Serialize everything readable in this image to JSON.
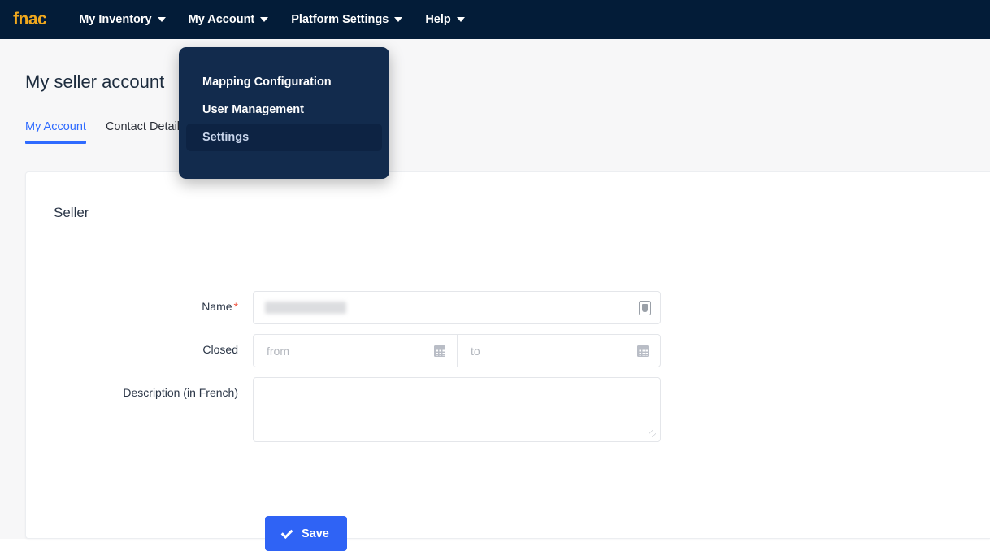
{
  "brand": {
    "name": "fnac",
    "color": "#f0a81e"
  },
  "navbar": {
    "background": "#031c38",
    "items": [
      {
        "label": "My Inventory",
        "has_caret": true
      },
      {
        "label": "My Account",
        "has_caret": true
      },
      {
        "label": "Platform Settings",
        "has_caret": true
      },
      {
        "label": "Help",
        "has_caret": true
      }
    ]
  },
  "dropdown": {
    "open_for": "My Account",
    "background": "#122b4d",
    "items": [
      {
        "label": "Mapping Configuration",
        "active": false
      },
      {
        "label": "User Management",
        "active": false
      },
      {
        "label": "Settings",
        "active": true
      }
    ]
  },
  "page": {
    "title": "My seller account",
    "accent_color": "#2f6bff"
  },
  "tabs": [
    {
      "label": "My Account",
      "active": true
    },
    {
      "label": "Contact Details",
      "active": false
    }
  ],
  "card": {
    "title": "Seller",
    "fields": {
      "name": {
        "label": "Name",
        "required_marker": "*",
        "value": "",
        "icon": "id-card-icon"
      },
      "closed": {
        "label": "Closed",
        "from_placeholder": "from",
        "from_value": "",
        "to_placeholder": "to",
        "to_value": "",
        "icon": "calendar-icon"
      },
      "description": {
        "label": "Description (in French)",
        "value": "",
        "placeholder": ""
      }
    },
    "save_button": {
      "label": "Save",
      "icon": "check-icon",
      "color": "#2f63f5"
    }
  }
}
